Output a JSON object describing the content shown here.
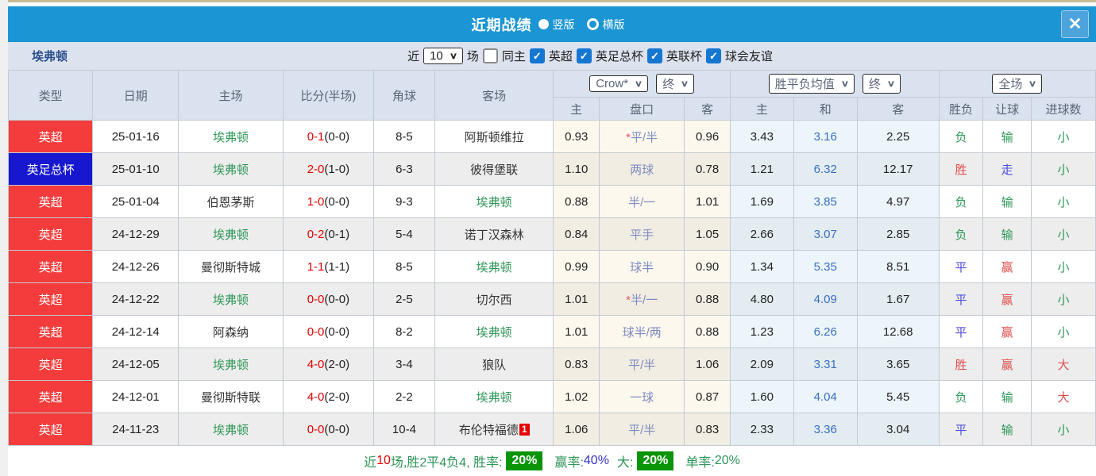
{
  "titlebar": {
    "title": "近期战绩",
    "vertical_label": "竖版",
    "horizontal_label": "横版"
  },
  "filter": {
    "team": "埃弗顿",
    "near_label": "近",
    "count_value": "10",
    "matches_label": "场",
    "same_home_label": "同主",
    "same_home_state": "",
    "leagues": [
      {
        "label": "英超",
        "state": "checked"
      },
      {
        "label": "英足总杯",
        "state": "checked"
      },
      {
        "label": "英联杯",
        "state": "checked"
      },
      {
        "label": "球会友谊",
        "state": "checked"
      }
    ]
  },
  "header": {
    "main_cols": [
      "类型",
      "日期",
      "主场",
      "比分(半场)",
      "角球",
      "客场"
    ],
    "crow_select": "Crow*",
    "final_select_1": "终",
    "avg_select": "胜平负均值",
    "final_select_2": "终",
    "scope_select": "全场",
    "crow_cols": [
      "主",
      "盘口",
      "客"
    ],
    "avg_cols": [
      "主",
      "和",
      "客"
    ],
    "result_cols": [
      "胜负",
      "让球",
      "进球数"
    ]
  },
  "rows": [
    {
      "league": "英超",
      "league_color": "lred",
      "date": "25-01-16",
      "home": "埃弗顿",
      "home_color": "self",
      "score": "0-1",
      "half": "(0-0)",
      "corner": "8-5",
      "away": "阿斯顿维拉",
      "away_color": "other",
      "away_badge": "",
      "crow_home": "0.93",
      "crow_star": "*",
      "crow_pk": "平/半",
      "crow_away": "0.96",
      "avg_home": "3.43",
      "avg_draw": "3.16",
      "avg_away": "2.25",
      "result": "负",
      "result_color": "green",
      "handicap": "输",
      "handicap_color": "green",
      "goals": "小",
      "goals_color": "green"
    },
    {
      "league": "英足总杯",
      "league_color": "lblue",
      "date": "25-01-10",
      "home": "埃弗顿",
      "home_color": "self",
      "score": "2-0",
      "half": "(1-0)",
      "corner": "6-3",
      "away": "彼得堡联",
      "away_color": "other",
      "away_badge": "",
      "crow_home": "1.10",
      "crow_star": "",
      "crow_pk": "两球",
      "crow_away": "0.78",
      "avg_home": "1.21",
      "avg_draw": "6.32",
      "avg_away": "12.17",
      "result": "胜",
      "result_color": "red",
      "handicap": "走",
      "handicap_color": "blue",
      "goals": "小",
      "goals_color": "green"
    },
    {
      "league": "英超",
      "league_color": "lred",
      "date": "25-01-04",
      "home": "伯恩茅斯",
      "home_color": "other",
      "score": "1-0",
      "half": "(0-0)",
      "corner": "9-3",
      "away": "埃弗顿",
      "away_color": "self",
      "away_badge": "",
      "crow_home": "0.88",
      "crow_star": "",
      "crow_pk": "半/一",
      "crow_away": "1.01",
      "avg_home": "1.69",
      "avg_draw": "3.85",
      "avg_away": "4.97",
      "result": "负",
      "result_color": "green",
      "handicap": "输",
      "handicap_color": "green",
      "goals": "小",
      "goals_color": "green"
    },
    {
      "league": "英超",
      "league_color": "lred",
      "date": "24-12-29",
      "home": "埃弗顿",
      "home_color": "self",
      "score": "0-2",
      "half": "(0-1)",
      "corner": "5-4",
      "away": "诺丁汉森林",
      "away_color": "other",
      "away_badge": "",
      "crow_home": "0.84",
      "crow_star": "",
      "crow_pk": "平手",
      "crow_away": "1.05",
      "avg_home": "2.66",
      "avg_draw": "3.07",
      "avg_away": "2.85",
      "result": "负",
      "result_color": "green",
      "handicap": "输",
      "handicap_color": "green",
      "goals": "小",
      "goals_color": "green"
    },
    {
      "league": "英超",
      "league_color": "lred",
      "date": "24-12-26",
      "home": "曼彻斯特城",
      "home_color": "other",
      "score": "1-1",
      "half": "(1-1)",
      "corner": "8-5",
      "away": "埃弗顿",
      "away_color": "self",
      "away_badge": "",
      "crow_home": "0.99",
      "crow_star": "",
      "crow_pk": "球半",
      "crow_away": "0.90",
      "avg_home": "1.34",
      "avg_draw": "5.35",
      "avg_away": "8.51",
      "result": "平",
      "result_color": "blue",
      "handicap": "赢",
      "handicap_color": "red",
      "goals": "小",
      "goals_color": "green"
    },
    {
      "league": "英超",
      "league_color": "lred",
      "date": "24-12-22",
      "home": "埃弗顿",
      "home_color": "self",
      "score": "0-0",
      "half": "(0-0)",
      "corner": "2-5",
      "away": "切尔西",
      "away_color": "other",
      "away_badge": "",
      "crow_home": "1.01",
      "crow_star": "*",
      "crow_pk": "半/一",
      "crow_away": "0.88",
      "avg_home": "4.80",
      "avg_draw": "4.09",
      "avg_away": "1.67",
      "result": "平",
      "result_color": "blue",
      "handicap": "赢",
      "handicap_color": "red",
      "goals": "小",
      "goals_color": "green"
    },
    {
      "league": "英超",
      "league_color": "lred",
      "date": "24-12-14",
      "home": "阿森纳",
      "home_color": "other",
      "score": "0-0",
      "half": "(0-0)",
      "corner": "8-2",
      "away": "埃弗顿",
      "away_color": "self",
      "away_badge": "",
      "crow_home": "1.01",
      "crow_star": "",
      "crow_pk": "球半/两",
      "crow_away": "0.88",
      "avg_home": "1.23",
      "avg_draw": "6.26",
      "avg_away": "12.68",
      "result": "平",
      "result_color": "blue",
      "handicap": "赢",
      "handicap_color": "red",
      "goals": "小",
      "goals_color": "green"
    },
    {
      "league": "英超",
      "league_color": "lred",
      "date": "24-12-05",
      "home": "埃弗顿",
      "home_color": "self",
      "score": "4-0",
      "half": "(2-0)",
      "corner": "3-4",
      "away": "狼队",
      "away_color": "other",
      "away_badge": "",
      "crow_home": "0.83",
      "crow_star": "",
      "crow_pk": "平/半",
      "crow_away": "1.06",
      "avg_home": "2.09",
      "avg_draw": "3.31",
      "avg_away": "3.65",
      "result": "胜",
      "result_color": "red",
      "handicap": "赢",
      "handicap_color": "red",
      "goals": "大",
      "goals_color": "red"
    },
    {
      "league": "英超",
      "league_color": "lred",
      "date": "24-12-01",
      "home": "曼彻斯特联",
      "home_color": "other",
      "score": "4-0",
      "half": "(2-0)",
      "corner": "2-2",
      "away": "埃弗顿",
      "away_color": "self",
      "away_badge": "",
      "crow_home": "1.02",
      "crow_star": "",
      "crow_pk": "一球",
      "crow_away": "0.87",
      "avg_home": "1.60",
      "avg_draw": "4.04",
      "avg_away": "5.45",
      "result": "负",
      "result_color": "green",
      "handicap": "输",
      "handicap_color": "green",
      "goals": "大",
      "goals_color": "red"
    },
    {
      "league": "英超",
      "league_color": "lred",
      "date": "24-11-23",
      "home": "埃弗顿",
      "home_color": "self",
      "score": "0-0",
      "half": "(0-0)",
      "corner": "10-4",
      "away": "布伦特福德",
      "away_color": "other",
      "away_badge": "1",
      "crow_home": "1.06",
      "crow_star": "",
      "crow_pk": "平/半",
      "crow_away": "0.83",
      "avg_home": "2.33",
      "avg_draw": "3.36",
      "avg_away": "3.04",
      "result": "平",
      "result_color": "blue",
      "handicap": "输",
      "handicap_color": "green",
      "goals": "小",
      "goals_color": "green"
    }
  ],
  "footer": {
    "recent_label": "近",
    "recent_count": "10",
    "summary": "场,胜2平4负4, 胜率:",
    "win_rate": "20%",
    "win_odds_label": "赢率:",
    "win_odds_value": "40%",
    "big_label": "大:",
    "big_rate": "20%",
    "single_label": "单率:",
    "single_value": "20%"
  }
}
